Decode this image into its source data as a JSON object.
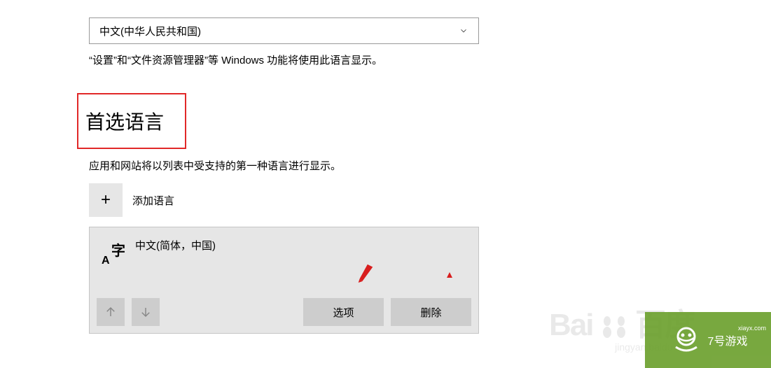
{
  "display_language": {
    "dropdown_value": "中文(中华人民共和国)",
    "helper_text": "“设置”和“文件资源管理器”等 Windows 功能将使用此语言显示。"
  },
  "preferred_languages": {
    "heading": "首选语言",
    "description": "应用和网站将以列表中受支持的第一种语言进行显示。",
    "add_language_label": "添加语言",
    "glyph_large_char": "字",
    "glyph_small_char": "A",
    "items": [
      {
        "name": "中文(简体，中国)"
      }
    ],
    "options_button_label": "选项",
    "remove_button_label": "删除"
  },
  "annotations": {
    "highlighted_heading": true,
    "arrow_points_to": "options_button"
  },
  "watermarks": {
    "baidu_logo": "Bai",
    "baidu_logo_2": "百度",
    "baidu_sub": "jingyan.baidu.com",
    "green_brand": "7号游戏",
    "green_sub": "xiayx.com"
  }
}
